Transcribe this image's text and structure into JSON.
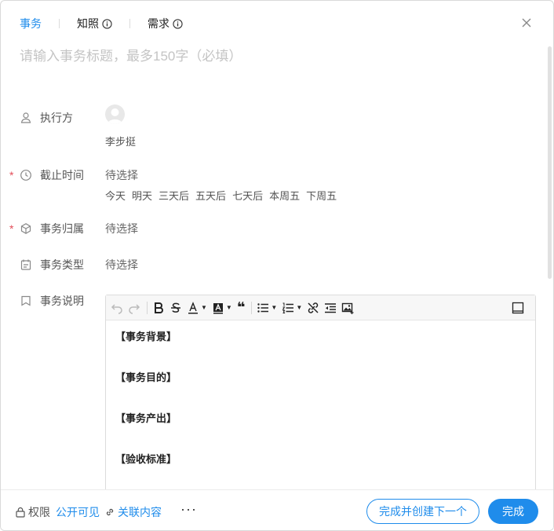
{
  "tabs": [
    {
      "label": "事务",
      "active": true
    },
    {
      "label": "知照",
      "active": false,
      "info": true
    },
    {
      "label": "需求",
      "active": false,
      "info": true
    }
  ],
  "title_placeholder": "请输入事务标题，最多150字（必填）",
  "assignee": {
    "label": "执行方",
    "name": "李步挺"
  },
  "deadline": {
    "label": "截止时间",
    "required_mark": "*",
    "value": "待选择",
    "quick": [
      "今天",
      "明天",
      "三天后",
      "五天后",
      "七天后",
      "本周五",
      "下周五"
    ]
  },
  "belong": {
    "label": "事务归属",
    "required_mark": "*",
    "value": "待选择"
  },
  "type": {
    "label": "事务类型",
    "value": "待选择"
  },
  "description": {
    "label": "事务说明",
    "toolbar": {
      "quote_label": "❝"
    },
    "lines": [
      "【事务背景】",
      "【事务目的】",
      "【事务产出】",
      "【验收标准】"
    ]
  },
  "footer": {
    "permission_label": "权限",
    "permission_value": "公开可见",
    "related_label": "关联内容",
    "more_label": "···",
    "secondary_button": "完成并创建下一个",
    "primary_button": "完成"
  },
  "colors": {
    "accent": "#1f8ceb",
    "required": "#e34d59"
  }
}
